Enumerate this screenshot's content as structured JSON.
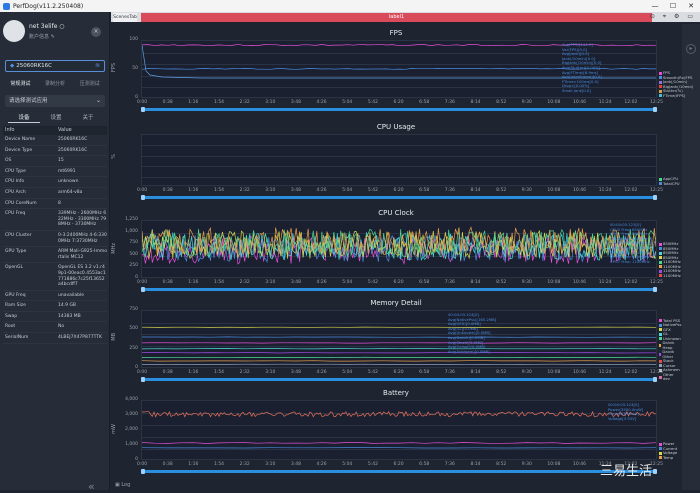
{
  "window": {
    "title": "PerfDog(v11.2.250408)",
    "minimize": "—",
    "maximize": "☐",
    "close": "✕"
  },
  "user": {
    "name": "net 3elife ○",
    "info": "账户信息 ✎"
  },
  "device": {
    "name": "25060RK16C"
  },
  "mode_tabs": [
    "常规测试",
    "录制分析",
    "压测测试"
  ],
  "app_select": {
    "placeholder": "请选择测试应用"
  },
  "side_tabs": [
    "设备",
    "设置",
    "关于"
  ],
  "info_header": {
    "key": "Info",
    "value": "Value"
  },
  "info_rows": [
    {
      "k": "Device Name",
      "v": "25060RK16C"
    },
    {
      "k": "Device Type",
      "v": "25060RK16C"
    },
    {
      "k": "OS",
      "v": "15"
    },
    {
      "k": "CPU Type",
      "v": "mt6991"
    },
    {
      "k": "CPU Info",
      "v": "unknown"
    },
    {
      "k": "CPU Arch",
      "v": "arm64-v8a"
    },
    {
      "k": "CPU CoreNum",
      "v": "8"
    },
    {
      "k": "CPU Freq",
      "v": "339MHz - 2600MHz 622MHz - 3300MHz 798MHz - 3730MHz"
    },
    {
      "k": "CPU Cluster",
      "v": "0-3:2400MHz 4-6:3300MHz 7:3730MHz"
    },
    {
      "k": "GPU Type",
      "v": "ARM Mali-G925-Immortalis MC12"
    },
    {
      "k": "OpenGL",
      "v": "OpenGL ES 3.2 v1.r49p1-00eac0.4553ac1771886c7c25f13652a4bcdff7"
    },
    {
      "k": "GPU Freq",
      "v": "unavailable"
    },
    {
      "k": "Ram Size",
      "v": "14.9 GB"
    },
    {
      "k": "Swap",
      "v": "14383 MB"
    },
    {
      "k": "Root",
      "v": "No"
    },
    {
      "k": "SerialNum",
      "v": "4LBEJ7X47P877TTK"
    }
  ],
  "tabs": {
    "first": "ScenesTab",
    "second": "label1"
  },
  "toolbar_icons": "⊙ ⌖ ⚙ ▭",
  "time_axis": [
    "0:00",
    "0:38",
    "1:16",
    "1:54",
    "2:32",
    "3:10",
    "3:48",
    "4:26",
    "5:04",
    "5:42",
    "6:20",
    "6:58",
    "7:36",
    "8:14",
    "8:52",
    "9:30",
    "10:08",
    "10:46",
    "11:24",
    "12:02",
    "12:25"
  ],
  "panels": [
    {
      "title": "FPS",
      "ylabel": "FPS",
      "yticks": [
        "100",
        "50",
        "0"
      ],
      "legend": [
        {
          "label": "FPS",
          "color": "#e84fd8"
        },
        {
          "label": "Smooth(Rx)FPS",
          "color": "#4a8bde"
        },
        {
          "label": "Jank(/10min)",
          "color": "#8f6fd8"
        },
        {
          "label": "BigJank(/10min)",
          "color": "#e84040"
        },
        {
          "label": "Stutter(%)",
          "color": "#d8a040"
        },
        {
          "label": "FTime(IFPS)",
          "color": "#40c0d8"
        }
      ],
      "tip": [
        "Avg(FPS)[144.0]",
        "Var(FPS)[0.0]",
        "Avg(Jank)[0.0]",
        "Jank(/10min)[0.0]",
        "BigJank(/10min)[0.0]",
        "Avg(Stutter)[0.00%]",
        "Avg(FTime)[6.9ms]",
        "Avg(InterFrame)[0.0]",
        "FTime>100ms[0.0]",
        "Drop>[0.00%]",
        "Small Jank[0.0]"
      ]
    },
    {
      "title": "CPU Usage",
      "ylabel": "%",
      "yticks": [
        "",
        ""
      ],
      "legend": [
        {
          "label": "AppCPU",
          "color": "#4ad88f"
        },
        {
          "label": "TotalCPU",
          "color": "#4a8bde"
        }
      ],
      "tip": []
    },
    {
      "title": "CPU Clock",
      "ylabel": "MHz",
      "yticks": [
        "1,250",
        "1,000",
        "750",
        "500",
        "250",
        "0"
      ],
      "legend": [
        {
          "label": "850MHz",
          "color": "#e84fd8"
        },
        {
          "label": "850MHz",
          "color": "#4a8bde"
        },
        {
          "label": "850MHz",
          "color": "#4ad8d8"
        },
        {
          "label": "850MHz",
          "color": "#d8d84a"
        },
        {
          "label": "1100MHz",
          "color": "#4ad88f"
        },
        {
          "label": "1100MHz",
          "color": "#e8a04a"
        },
        {
          "label": "1100MHz",
          "color": "#a04ae8"
        },
        {
          "label": "1100MHz",
          "color": "#e84a4a"
        }
      ],
      "tip": [
        "00:04:03.123[0]",
        "CPU0 Freq: 850MHz",
        "CPU1 Freq: 850MHz",
        "CPU2 Freq: 850MHz",
        "CPU3 Freq: 850MHz",
        "CPU4 Freq: 1100MHz",
        "CPU5 Freq: 1100MHz",
        "CPU6 Freq: 1100MHz",
        "CPU7 Freq: 1100MHz"
      ]
    },
    {
      "title": "Memory Detail",
      "ylabel": "MB",
      "yticks": [
        "750",
        "500",
        "250",
        "0"
      ],
      "legend": [
        {
          "label": "Total PSS",
          "color": "#e84fd8"
        },
        {
          "label": "NativePss",
          "color": "#4a8bde"
        },
        {
          "label": "GFX",
          "color": "#d8d84a"
        },
        {
          "label": "GL",
          "color": "#4ad8d8"
        },
        {
          "label": "Unknown",
          "color": "#4ad88f"
        },
        {
          "label": "Dalvik Heap",
          "color": "#e8a04a"
        },
        {
          "label": "Dalvik Other",
          "color": "#a04ae8"
        },
        {
          "label": "Stack",
          "color": "#e84a4a"
        },
        {
          "label": "Cursor",
          "color": "#8fa0b8"
        },
        {
          "label": "Ashmem",
          "color": "#c8c8c8"
        },
        {
          "label": "Other dev",
          "color": "#d86fa0"
        }
      ],
      "tip": [
        "00:04:03.124[0]",
        "Avg(NativePss)[165.2MB]",
        "Avg(GFX)[0.0MB]",
        "Avg(GL)[0.0MB]",
        "Avg(Unknown)[0.0MB]",
        "Avg(Dalvik)[0.0MB]",
        "Avg(Stack)[0.0MB]",
        "Avg(Cursor)[0.0MB]",
        "Avg(Ashmem)[0.0MB]"
      ]
    },
    {
      "title": "Battery",
      "ylabel": "mW",
      "yticks": [
        "4,000",
        "3,000",
        "2,000",
        "1,000",
        "0"
      ],
      "legend": [
        {
          "label": "Power",
          "color": "#e84fd8"
        },
        {
          "label": "Current",
          "color": "#4a8bde"
        },
        {
          "label": "Voltage",
          "color": "#d8d84a"
        },
        {
          "label": "Temp",
          "color": "#e8a04a"
        }
      ],
      "tip": [
        "00:04:03.124[0]",
        "Power[3500.0mW]",
        "Current[890mA]",
        "Voltage[3.93V]"
      ]
    }
  ],
  "bottom": {
    "log": "Log"
  },
  "watermark": "三易生活"
}
